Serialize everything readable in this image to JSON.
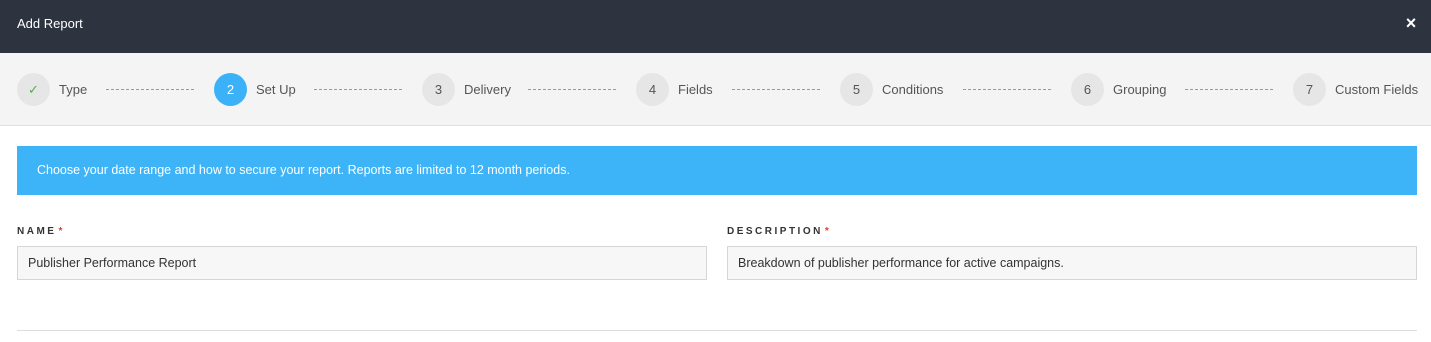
{
  "header": {
    "title": "Add Report",
    "close_icon": "×"
  },
  "steps": [
    {
      "number": "✓",
      "label": "Type",
      "status": "completed",
      "icon": "check-icon"
    },
    {
      "number": "2",
      "label": "Set Up",
      "status": "active"
    },
    {
      "number": "3",
      "label": "Delivery",
      "status": "pending"
    },
    {
      "number": "4",
      "label": "Fields",
      "status": "pending"
    },
    {
      "number": "5",
      "label": "Conditions",
      "status": "pending"
    },
    {
      "number": "6",
      "label": "Grouping",
      "status": "pending"
    },
    {
      "number": "7",
      "label": "Custom Fields",
      "status": "pending"
    }
  ],
  "banner": {
    "text": "Choose your date range and how to secure your report. Reports are limited to 12 month periods."
  },
  "form": {
    "name": {
      "label": "NAME",
      "required_mark": "*",
      "value": "Publisher Performance Report"
    },
    "description": {
      "label": "DESCRIPTION",
      "required_mark": "*",
      "value": "Breakdown of publisher performance for active campaigns."
    }
  },
  "colors": {
    "header_bg": "#2d3440",
    "accent": "#3bb2f7",
    "banner_bg": "#3db4f8",
    "required": "#e53935",
    "check": "#4caf50"
  }
}
